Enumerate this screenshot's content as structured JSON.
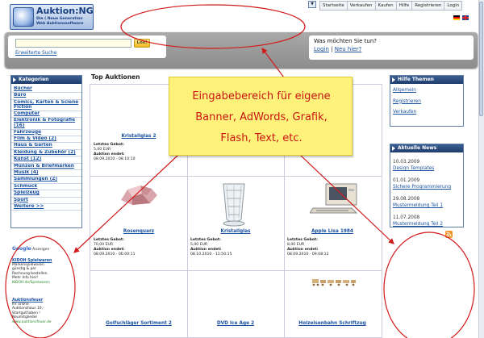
{
  "header": {
    "logo_name": "Auktion:NG",
    "logo_sub1": "Die ( Neue Generation",
    "logo_sub2": "Web Auktionssoftware",
    "nav": [
      "Startseite",
      "Verkaufen",
      "Kaufen",
      "Hilfe",
      "Registrieren",
      "Login"
    ],
    "dropdown_glyph": "▼"
  },
  "search": {
    "value": "",
    "button": "Los!",
    "advanced": "Erweiterte Suche"
  },
  "login": {
    "question": "Was möchten Sie tun?",
    "login": "Login",
    "separator": "|",
    "new": "Neu hier?"
  },
  "categories": {
    "title": "Kategorien",
    "items": [
      "Bücher",
      "Büro",
      "Comics, Karten & Sciene Fiction",
      "Computer",
      "Elektronik & Fotografie (16)",
      "Fahrzeuge",
      "Film & Video (2)",
      "Haus & Garten",
      "Kleidung & Zubehör (2)",
      "Kunst (12)",
      "Münzen & Briefmarken",
      "Musik (4)",
      "Sammlungen (2)",
      "Schmuck",
      "Spielzeug",
      "Sport",
      "Weitere >>"
    ]
  },
  "google_ads": {
    "label_google": "Google",
    "label_ads": "-Anzeigen",
    "ads": [
      {
        "title": "KIDOH Spielwaren",
        "lines": [
          "Markenspielwaren",
          "günstig & per",
          "Rechnung bestellen.",
          "Mehr Info hier!"
        ],
        "url": "KIDOH.de/Spielwaren"
      },
      {
        "title": "Auktionsfeuer",
        "lines": [
          "Ihr online",
          "Auktionshaus 10,-",
          "Startguthaben !",
          "Neumitglieder"
        ],
        "url": "www.auktionsfeuer.de"
      }
    ]
  },
  "main": {
    "title": "Top Auktionen",
    "labels": {
      "bid": "Letztes Gebot:",
      "ends": "Auktion endet:"
    },
    "auctions": [
      {
        "title": "Kristallglas 2",
        "bid": "5,00 EUR",
        "ends": "08.09.2010 - 08:10:10"
      },
      {
        "title": "Rosenquarz",
        "bid": "70,00 EUR",
        "ends": "08.09.2010 - 06:00:11"
      },
      {
        "title": "Kristallglas",
        "bid": "5,00 EUR",
        "ends": "08.10.2010 - 11:50:15"
      },
      {
        "title": "Apple Lisa 1984",
        "bid": "8,00 EUR",
        "ends": "08.09.2010 - 09:08:12"
      },
      {
        "title": "Golfschläger Sortiment 2"
      },
      {
        "title": "DVD Ice Age 2"
      },
      {
        "title": "Holzeisenbahn Schriftzug"
      }
    ]
  },
  "help": {
    "title": "Hilfe Themen",
    "items": [
      "Allgemein",
      "Registrieren",
      "Verkaufen"
    ]
  },
  "news": {
    "title": "Aktuelle News",
    "items": [
      {
        "date": "10.03.2009",
        "link": "Design Templates"
      },
      {
        "date": "01.01.2009",
        "link": "Sichere Programmierung"
      },
      {
        "date": "29.08.2008",
        "link": "Mustermeldung Teil 1"
      },
      {
        "date": "11.07.2008",
        "link": "Mustermeldung Teil 2"
      }
    ]
  },
  "annotation": {
    "lines": [
      "Eingabebereich für eigene",
      "Banner, AdWords, Grafik,",
      "Flash, Text, etc."
    ],
    "color": "#c81414",
    "bg": "#fff27a"
  },
  "colors": {
    "accent": "#1a52a0",
    "panel_header": "#2a4a7e",
    "search_button": "#f5c53a"
  }
}
